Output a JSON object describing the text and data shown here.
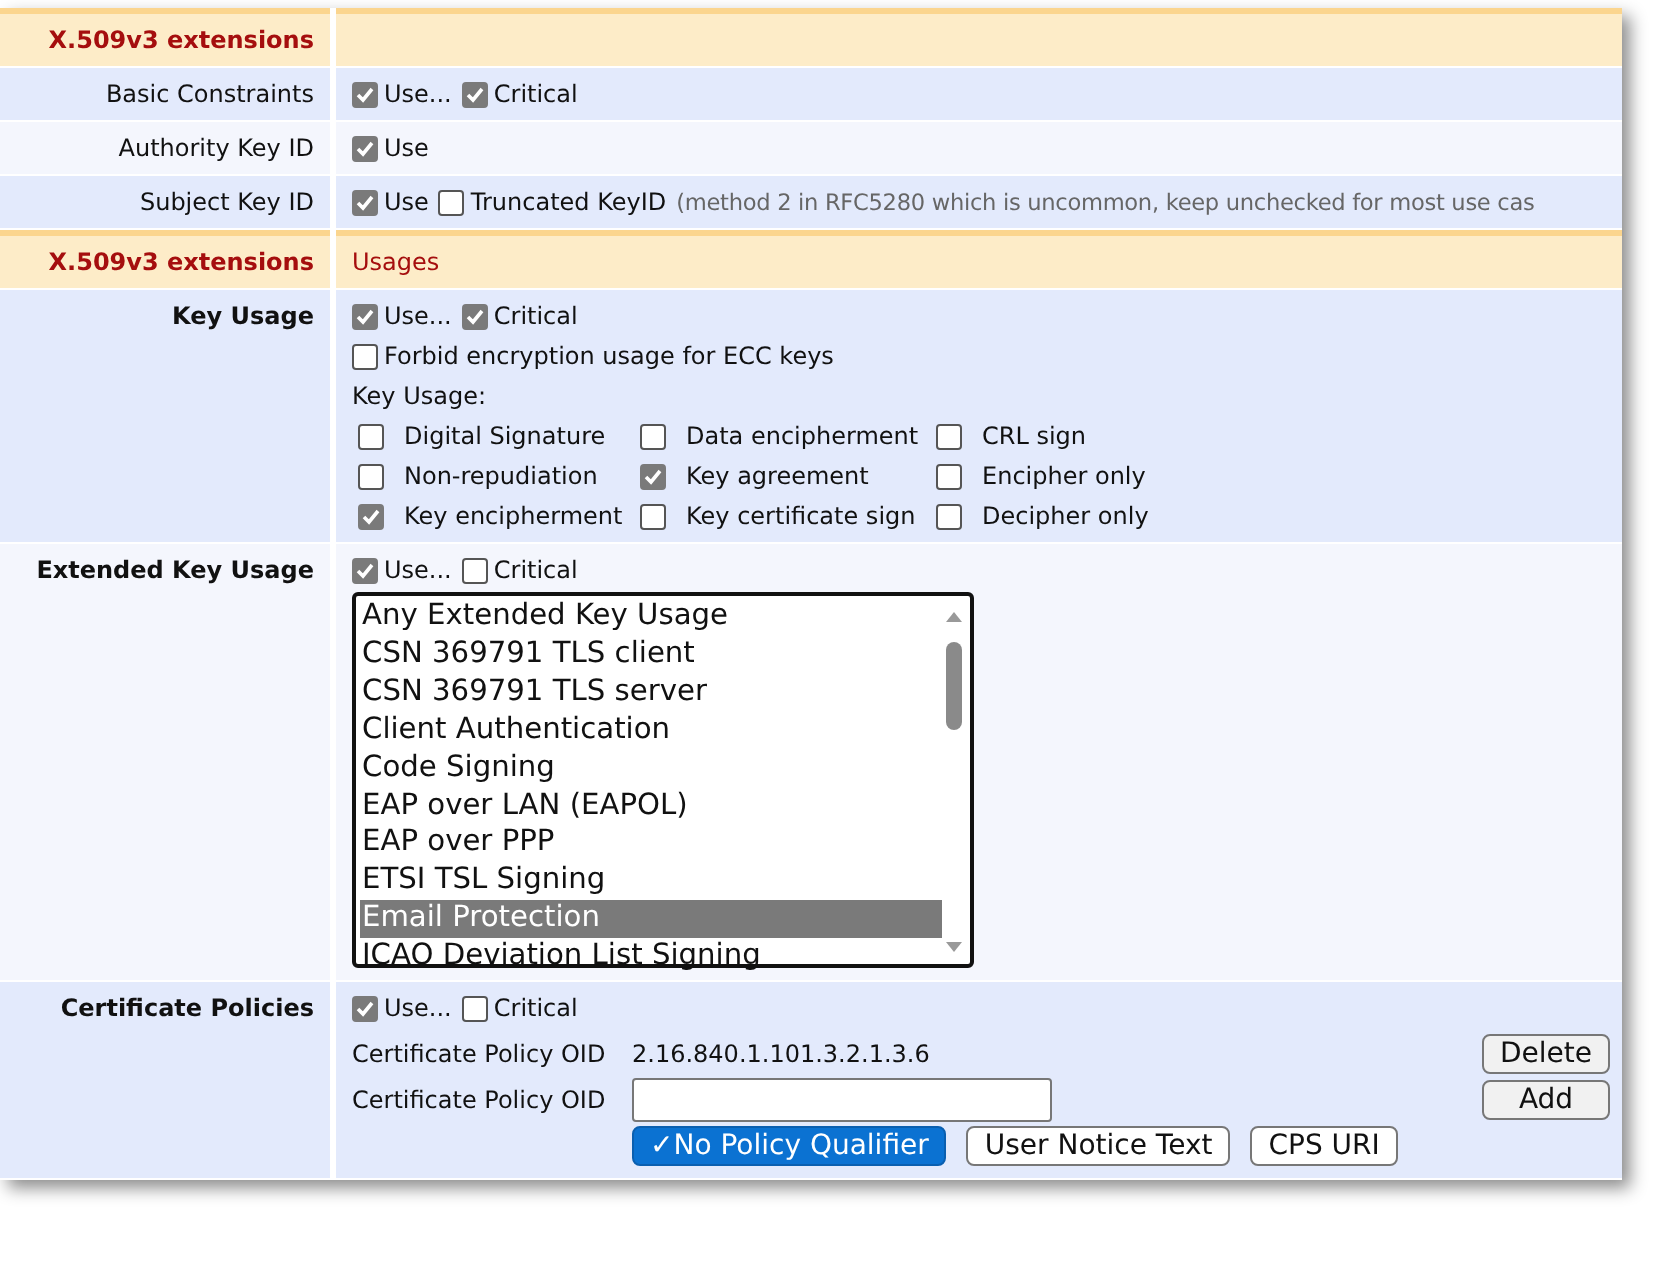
{
  "rows": [
    {
      "kind": "header",
      "label": "X.509v3 extensions"
    },
    {
      "kind": "options",
      "label": "Basic Constraints",
      "emphasis": false,
      "options": [
        {
          "label": "Use...",
          "checked": true
        },
        {
          "label": "Critical",
          "checked": true
        }
      ]
    },
    {
      "kind": "options",
      "label": "Authority Key ID",
      "emphasis": false,
      "options": [
        {
          "label": "Use",
          "checked": true
        }
      ]
    },
    {
      "kind": "options",
      "label": "Subject Key ID",
      "emphasis": false,
      "options": [
        {
          "label": "Use",
          "checked": true
        },
        {
          "label": "Truncated KeyID",
          "checked": false
        }
      ],
      "hint": "(method 2 in RFC5280 which is uncommon, keep unchecked for most use cas"
    },
    {
      "kind": "header",
      "label": "X.509v3 extensions",
      "note": "Usages"
    },
    {
      "kind": "key_usage",
      "label": "Key Usage",
      "emphasis": true,
      "options": [
        {
          "label": "Use...",
          "checked": true
        },
        {
          "label": "Critical",
          "checked": true
        }
      ],
      "extra": {
        "label": "Forbid encryption usage for ECC keys",
        "checked": false
      },
      "grid_label": "Key Usage:",
      "grid": [
        {
          "label": "Digital Signature",
          "checked": false
        },
        {
          "label": "Data encipherment",
          "checked": false
        },
        {
          "label": "CRL sign",
          "checked": false
        },
        {
          "label": "Non-repudiation",
          "checked": false
        },
        {
          "label": "Key agreement",
          "checked": true
        },
        {
          "label": "Encipher only",
          "checked": false
        },
        {
          "label": "Key encipherment",
          "checked": true
        },
        {
          "label": "Key certificate sign",
          "checked": false
        },
        {
          "label": "Decipher only",
          "checked": false
        }
      ]
    },
    {
      "kind": "list",
      "label": "Extended Key Usage",
      "emphasis": true,
      "options": [
        {
          "label": "Use...",
          "checked": true
        },
        {
          "label": "Critical",
          "checked": false
        }
      ],
      "items": [
        {
          "label": "Any Extended Key Usage",
          "selected": false
        },
        {
          "label": "CSN 369791 TLS client",
          "selected": false
        },
        {
          "label": "CSN 369791 TLS server",
          "selected": false
        },
        {
          "label": "Client Authentication",
          "selected": false
        },
        {
          "label": "Code Signing",
          "selected": false
        },
        {
          "label": "EAP over LAN (EAPOL)",
          "selected": false
        },
        {
          "label": "EAP over PPP",
          "selected": false
        },
        {
          "label": "ETSI TSL Signing",
          "selected": false
        },
        {
          "label": "Email Protection",
          "selected": true
        },
        {
          "label": "ICAO Deviation List Signing",
          "selected": false
        }
      ]
    },
    {
      "kind": "policies",
      "label": "Certificate Policies",
      "emphasis": true,
      "options": [
        {
          "label": "Use...",
          "checked": true
        },
        {
          "label": "Critical",
          "checked": false
        }
      ],
      "oid_label": "Certificate Policy OID",
      "oid_value": "2.16.840.1.101.3.2.1.3.6",
      "input_label": "Certificate Policy OID",
      "delete": "Delete",
      "add": "Add",
      "qualifiers": [
        {
          "label": "✓No Policy Qualifier",
          "selected": true
        },
        {
          "label": "User Notice Text",
          "selected": false
        },
        {
          "label": "CPS URI",
          "selected": false
        }
      ]
    }
  ]
}
